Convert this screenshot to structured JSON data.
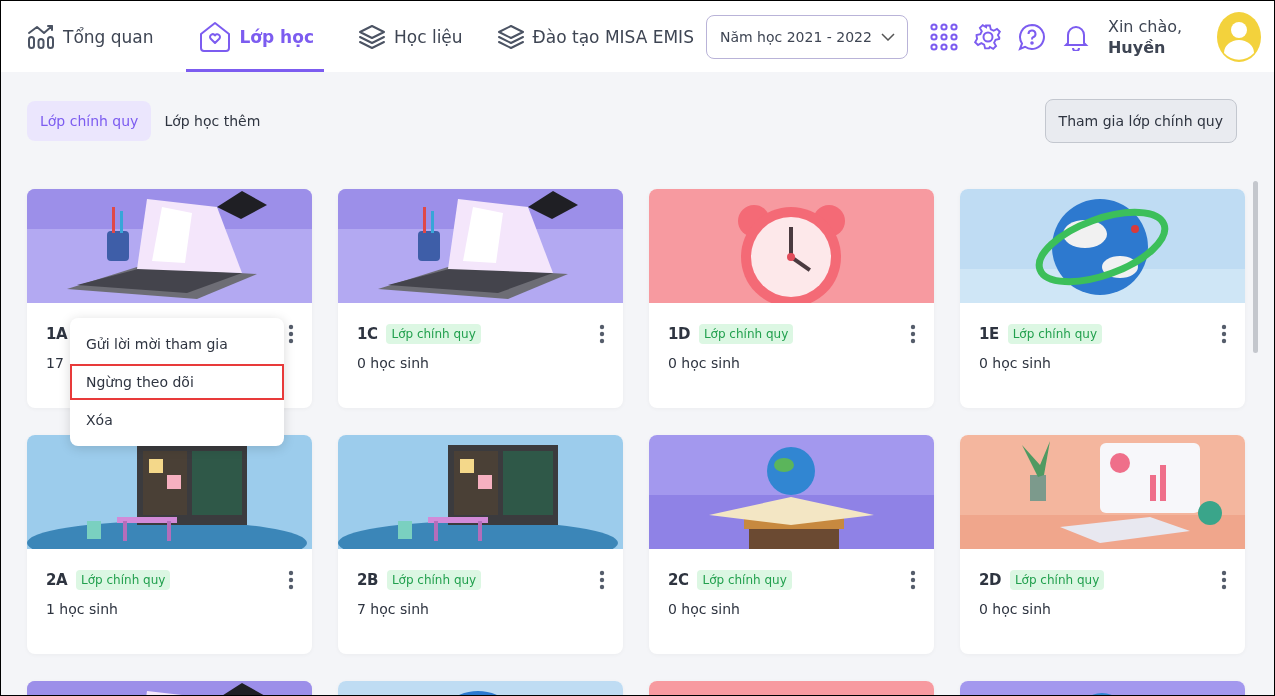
{
  "nav": [
    {
      "label": "Tổng quan",
      "selected": false
    },
    {
      "label": "Lớp học",
      "selected": true
    },
    {
      "label": "Học liệu",
      "selected": false
    },
    {
      "label": "Đào tạo MISA EMIS",
      "selected": false
    }
  ],
  "year_select": {
    "value": "Năm học 2021 - 2022"
  },
  "greeting": {
    "line_1": "Xin chào,",
    "name": "Huyền"
  },
  "tabs": [
    {
      "label": "Lớp chính quy",
      "selected": true
    },
    {
      "label": "Lớp học thêm",
      "selected": false
    }
  ],
  "join_button": "Tham gia lớp chính quy",
  "cards": [
    {
      "kind": "picture",
      "name": "1A",
      "count": "17",
      "menu": [
        {
          "label": "Gửi lời mời tham gia",
          "selected": false
        },
        {
          "label": "Ngừng theo dõi",
          "selected": true
        },
        {
          "label": "Xóa",
          "selected": false
        }
      ]
    },
    {
      "kind": "picture",
      "name": "1C",
      "tag": "Lớp chính quy",
      "count": "0 học sinh"
    },
    {
      "kind": "picture",
      "name": "1D",
      "tag": "Lớp chính quy",
      "count": "0 học sinh"
    },
    {
      "kind": "picture",
      "name": "1E",
      "tag": "Lớp chính quy",
      "count": "0 học sinh"
    },
    {
      "kind": "picture",
      "name": "2A",
      "tag": "Lớp chính quy",
      "count": "1 học sinh"
    },
    {
      "kind": "picture",
      "name": "2B",
      "tag": "Lớp chính quy",
      "count": "7 học sinh"
    },
    {
      "kind": "picture",
      "name": "2C",
      "tag": "Lớp chính quy",
      "count": "0 học sinh"
    },
    {
      "kind": "picture",
      "name": "2D",
      "tag": "Lớp chính quy",
      "count": "0 học sinh"
    },
    {
      "kind": "picture"
    },
    {
      "kind": "picture"
    },
    {
      "kind": "picture"
    },
    {
      "kind": "picture"
    }
  ]
}
